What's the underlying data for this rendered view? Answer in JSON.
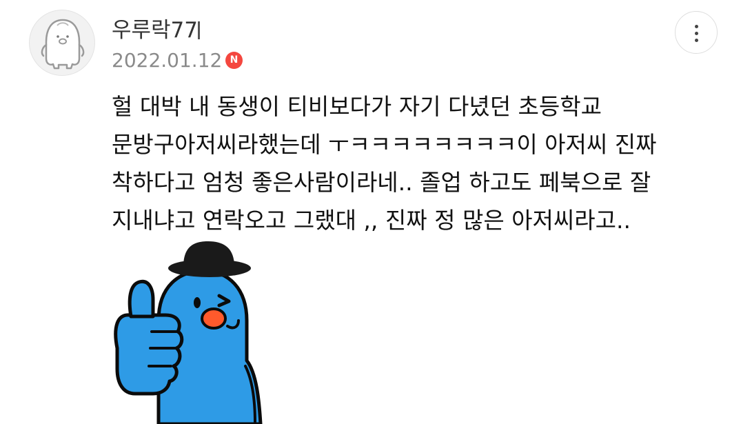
{
  "comment": {
    "author": "우루락77",
    "date": "2022.01.12",
    "badge_letter": "N",
    "badge_color": "#f4473f",
    "text_lines": [
      "헐 대박 내 동생이 티비보다가 자기 다녔던 초등학교",
      "문방구아저씨라했는데 ㅜㅋㅋㅋㅋㅋㅋㅋㅋ이 아저씨 진짜",
      "착하다고 엄청 좋은사람이라네.. 졸업 하고도 페북으로 잘",
      "지내냐고 연락오고 그랬대 ,, 진짜 정 많은 아저씨라고.."
    ],
    "avatar_icon": "penguin-avatar-icon",
    "more_icon": "more-vertical-icon",
    "sticker_icon": "blue-character-thumbs-up-sticker",
    "sticker_color": "#2e9be6"
  }
}
